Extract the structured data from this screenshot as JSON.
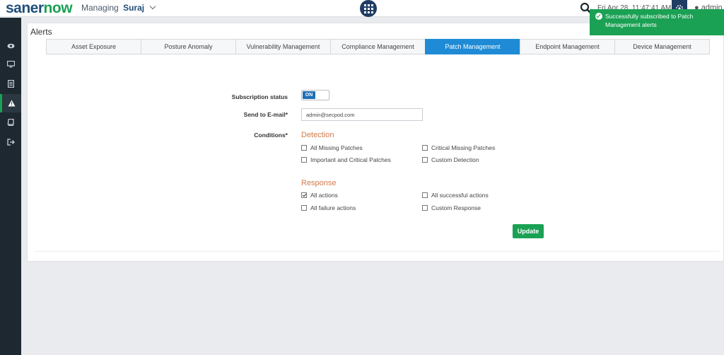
{
  "header": {
    "logo_part1": "saner",
    "logo_part2": "now",
    "managing_label": "Managing",
    "account_name": "Suraj",
    "datetime": "Fri Apr 28, 11:47:41 AM",
    "user": "admin"
  },
  "toast": {
    "message": "Successfully subscribed to Patch Management alerts"
  },
  "sidebar": {
    "items": [
      {
        "icon": "eye-icon"
      },
      {
        "icon": "monitor-icon"
      },
      {
        "icon": "document-icon"
      },
      {
        "icon": "warning-icon",
        "active": true
      },
      {
        "icon": "book-icon"
      },
      {
        "icon": "logout-icon"
      }
    ]
  },
  "page": {
    "title": "Alerts"
  },
  "tabs": [
    {
      "label": "Asset Exposure"
    },
    {
      "label": "Posture Anomaly"
    },
    {
      "label": "Vulnerability Management"
    },
    {
      "label": "Compliance Management"
    },
    {
      "label": "Patch Management",
      "active": true
    },
    {
      "label": "Endpoint Management"
    },
    {
      "label": "Device Management"
    }
  ],
  "form": {
    "subscription_label": "Subscription status",
    "subscription_value": "ON",
    "email_label": "Send to E-mail*",
    "email_value": "admin@secpod.com",
    "conditions_label": "Conditions*",
    "detection_heading": "Detection",
    "detection_options": [
      {
        "label": "All Missing Patches",
        "checked": false
      },
      {
        "label": "Critical Missing Patches",
        "checked": false
      },
      {
        "label": "Important and Critical Patches",
        "checked": false
      },
      {
        "label": "Custom Detection",
        "checked": false
      }
    ],
    "response_heading": "Response",
    "response_options": [
      {
        "label": "All actions",
        "checked": true
      },
      {
        "label": "All successful actions",
        "checked": false
      },
      {
        "label": "All failure actions",
        "checked": false
      },
      {
        "label": "Custom Response",
        "checked": false
      }
    ],
    "update_label": "Update"
  },
  "colors": {
    "brand_blue": "#1f4e79",
    "brand_green": "#1aa154",
    "active_tab": "#1f8bd6",
    "section_heading": "#d17a4c",
    "sidebar_bg": "#1e2830"
  }
}
